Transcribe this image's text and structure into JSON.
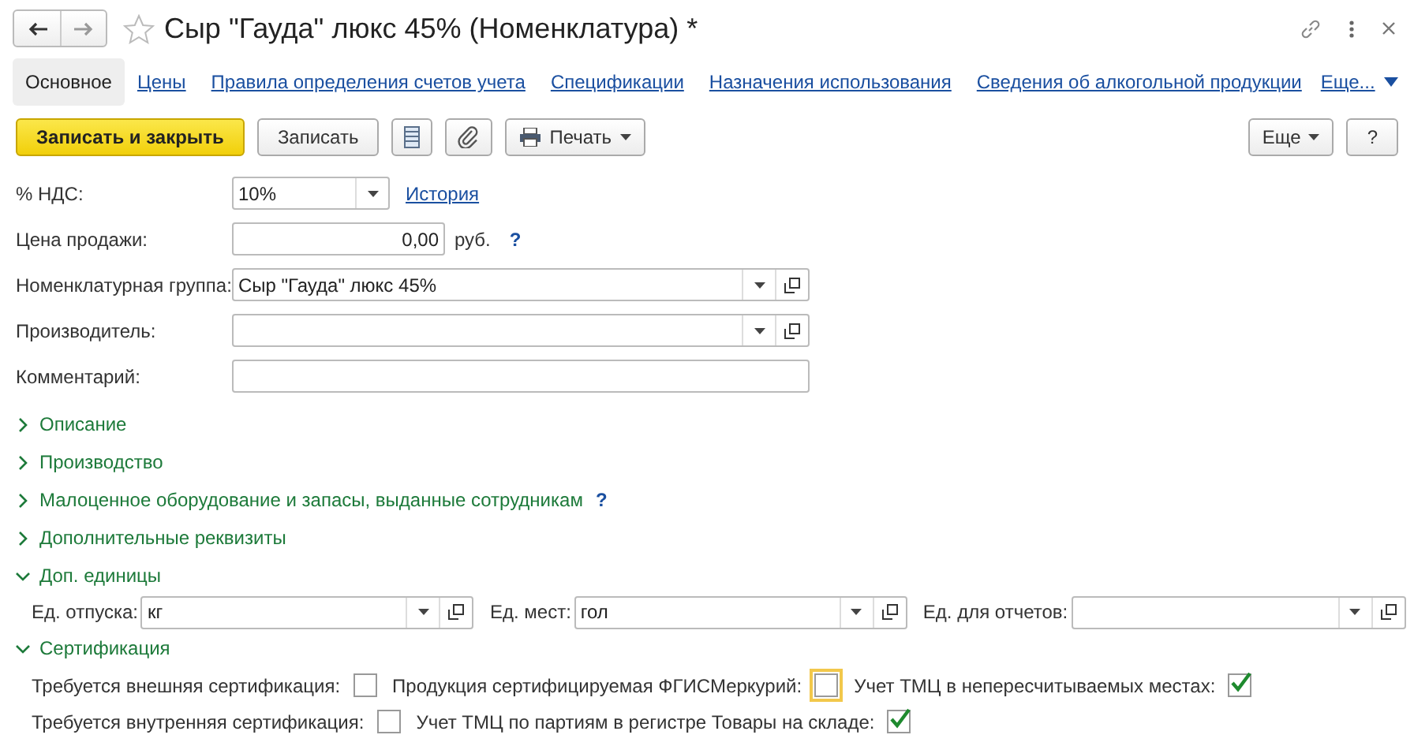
{
  "window": {
    "title": "Сыр \"Гауда\" люкс 45% (Номенклатура) *",
    "favorite": false
  },
  "tabs": [
    {
      "label": "Основное",
      "selected": true
    },
    {
      "label": "Цены",
      "selected": false
    },
    {
      "label": "Правила определения счетов учета",
      "selected": false
    },
    {
      "label": "Спецификации",
      "selected": false
    },
    {
      "label": "Назначения использования",
      "selected": false
    },
    {
      "label": "Сведения об алкогольной продукции",
      "selected": false
    }
  ],
  "more_tabs": "Еще...",
  "toolbar": [
    {
      "kind": "primary",
      "label": "Записать и закрыть"
    },
    {
      "kind": "plain",
      "label": "Записать"
    },
    {
      "kind": "list-icon"
    },
    {
      "kind": "clip-icon"
    },
    {
      "kind": "print",
      "label": "Печать"
    }
  ],
  "toolbar_right": [
    {
      "kind": "menu",
      "label": "Еще"
    },
    {
      "kind": "plain",
      "label": "?"
    }
  ],
  "fields": [
    {
      "kind": "select",
      "label": "% НДС:",
      "value": "10%",
      "link": "История"
    },
    {
      "kind": "number",
      "label": "Цена продажи:",
      "value": "0,00",
      "unit": "руб.",
      "help": "?"
    },
    {
      "kind": "ref",
      "label": "Номенклатурная группа:",
      "value": "Сыр \"Гауда\" люкс 45%"
    },
    {
      "kind": "ref",
      "label": "Производитель:"
    },
    {
      "kind": "text",
      "label": "Комментарий:"
    }
  ],
  "sections": [
    {
      "kind": "plain",
      "title": "Описание",
      "expanded": false
    },
    {
      "kind": "plain",
      "title": "Производство",
      "expanded": false
    },
    {
      "kind": "plain",
      "title": "Малоценное оборудование и запасы, выданные сотрудникам",
      "expanded": false,
      "help": "?"
    },
    {
      "kind": "plain",
      "title": "Дополнительные реквизиты",
      "expanded": false
    },
    {
      "kind": "units",
      "title": "Доп. единицы",
      "expanded": true,
      "fields": [
        {
          "label": "Ед. отпуска:",
          "value": "кг"
        },
        {
          "label": "Ед. мест:",
          "value": "гол"
        },
        {
          "label": "Ед. для отчетов:"
        }
      ]
    },
    {
      "kind": "checks",
      "title": "Сертификация",
      "expanded": true,
      "rows": [
        [
          {
            "label": "Требуется внешняя сертификация:",
            "checked": false,
            "focused": false
          },
          {
            "label": "Продукция сертифицируемая ФГИСМеркурий:",
            "checked": false,
            "focused": true
          },
          {
            "label": "Учет ТМЦ в непересчитываемых местах:",
            "checked": true,
            "focused": false
          }
        ],
        [
          {
            "label": "Требуется внутренняя сертификация:",
            "checked": false,
            "focused": false
          },
          {
            "label": "Учет ТМЦ по партиям в регистре Товары на складе:",
            "checked": true,
            "focused": false
          }
        ]
      ]
    }
  ]
}
